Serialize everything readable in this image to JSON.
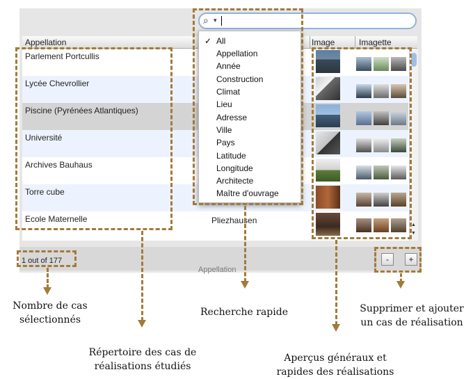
{
  "search": {
    "icon": "search-icon",
    "value": ""
  },
  "table": {
    "columns": [
      "Appellation",
      "Image",
      "Imagette"
    ],
    "rows": [
      {
        "appellation": "Parlement Portcullis",
        "ville": ""
      },
      {
        "appellation": "Lycée Chevrollier",
        "ville": ""
      },
      {
        "appellation": "Piscine (Pyrénées Atlantiques)",
        "ville": ""
      },
      {
        "appellation": "Université",
        "ville": ""
      },
      {
        "appellation": "Archives Bauhaus",
        "ville": ""
      },
      {
        "appellation": "Torre cube",
        "ville": ""
      },
      {
        "appellation": "Ecole Maternelle",
        "ville": "Pliezhausen"
      }
    ]
  },
  "search_menu": {
    "check": "✓",
    "items": [
      "All",
      "Appellation",
      "Année",
      "Construction",
      "Climat",
      "Lieu",
      "Adresse",
      "Ville",
      "Pays",
      "Latitude",
      "Longitude",
      "Architecte",
      "Maître d'ouvrage"
    ]
  },
  "status": {
    "count": "1 out of 177",
    "ghost_label": "Appellation"
  },
  "buttons": {
    "remove": "-",
    "add": "+"
  },
  "captions": {
    "count_line1": "Nombre de cas",
    "count_line2": "sélectionnés",
    "list_line1": "Répertoire des cas de",
    "list_line2": "réalisations étudiés",
    "search": "Recherche rapide",
    "preview_line1": "Aperçus généraux et",
    "preview_line2": "rapides des réalisations",
    "buttons_line1": "Supprimer et ajouter",
    "buttons_line2": "un cas de réalisation"
  },
  "colors": {
    "annotation": "#a27a3a",
    "selection": "#d4d4d4",
    "alt_row": "#edf3fe",
    "search_border": "#8fb2e3"
  }
}
